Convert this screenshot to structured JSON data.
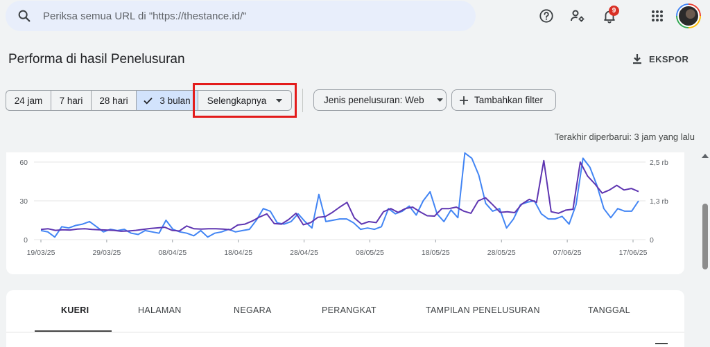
{
  "search": {
    "placeholder": "Periksa semua URL di \"https://thestance.id/\""
  },
  "notifications": {
    "count": "9"
  },
  "page": {
    "title": "Performa di hasil Penelusuran",
    "export_label": "EKSPOR"
  },
  "date_range": {
    "options": [
      "24 jam",
      "7 hari",
      "28 hari",
      "3 bulan"
    ],
    "selected": "3 bulan",
    "more_label": "Selengkapnya"
  },
  "filters": {
    "search_type": "Jenis penelusuran: Web",
    "add_filter": "Tambahkan filter"
  },
  "updated": "Terakhir diperbarui: 3 jam yang lalu",
  "chart_data": {
    "type": "line",
    "x_ticks": [
      "19/03/25",
      "29/03/25",
      "08/04/25",
      "18/04/25",
      "28/04/25",
      "08/05/25",
      "18/05/25",
      "28/05/25",
      "07/06/25",
      "17/06/25"
    ],
    "left_axis": {
      "ticks": [
        "0",
        "30",
        "60"
      ],
      "range": [
        0,
        60
      ]
    },
    "right_axis": {
      "ticks": [
        "0",
        "1,3 rb",
        "2,5 rb"
      ],
      "range": [
        0,
        2500
      ]
    },
    "series": [
      {
        "color": "#5e35b1",
        "axis": "right",
        "values": [
          330,
          350,
          300,
          320,
          310,
          340,
          350,
          330,
          320,
          310,
          300,
          270,
          280,
          300,
          330,
          360,
          380,
          400,
          300,
          280,
          440,
          350,
          340,
          350,
          350,
          340,
          320,
          470,
          500,
          600,
          730,
          830,
          520,
          500,
          650,
          850,
          480,
          550,
          720,
          740,
          880,
          1050,
          1200,
          700,
          500,
          580,
          550,
          900,
          1000,
          880,
          1000,
          1050,
          900,
          770,
          760,
          1000,
          1000,
          1050,
          920,
          850,
          1250,
          1350,
          1120,
          880,
          900,
          870,
          1150,
          1300,
          1200,
          2550,
          900,
          850,
          950,
          980,
          2500,
          2050,
          1800,
          1500,
          1600,
          1750,
          1600,
          1650,
          1550
        ]
      },
      {
        "color": "#4285f4",
        "axis": "left",
        "values": [
          7,
          6,
          2,
          10,
          9,
          11,
          12,
          14,
          10,
          6,
          8,
          7,
          8,
          5,
          4,
          7,
          6,
          5,
          15,
          8,
          6,
          5,
          3,
          7,
          2,
          5,
          6,
          8,
          6,
          7,
          8,
          15,
          24,
          22,
          13,
          12,
          14,
          20,
          14,
          9,
          35,
          14,
          15,
          16,
          16,
          13,
          8,
          9,
          8,
          10,
          24,
          20,
          22,
          26,
          19,
          30,
          37,
          20,
          14,
          23,
          17,
          67,
          63,
          50,
          28,
          22,
          24,
          9,
          16,
          27,
          29,
          30,
          20,
          16,
          16,
          18,
          12,
          27,
          63,
          56,
          42,
          24,
          17,
          24,
          22,
          22,
          30
        ]
      }
    ]
  },
  "tabs": [
    "KUERI",
    "HALAMAN",
    "NEGARA",
    "PERANGKAT",
    "TAMPILAN PENELUSURAN",
    "TANGGAL"
  ]
}
